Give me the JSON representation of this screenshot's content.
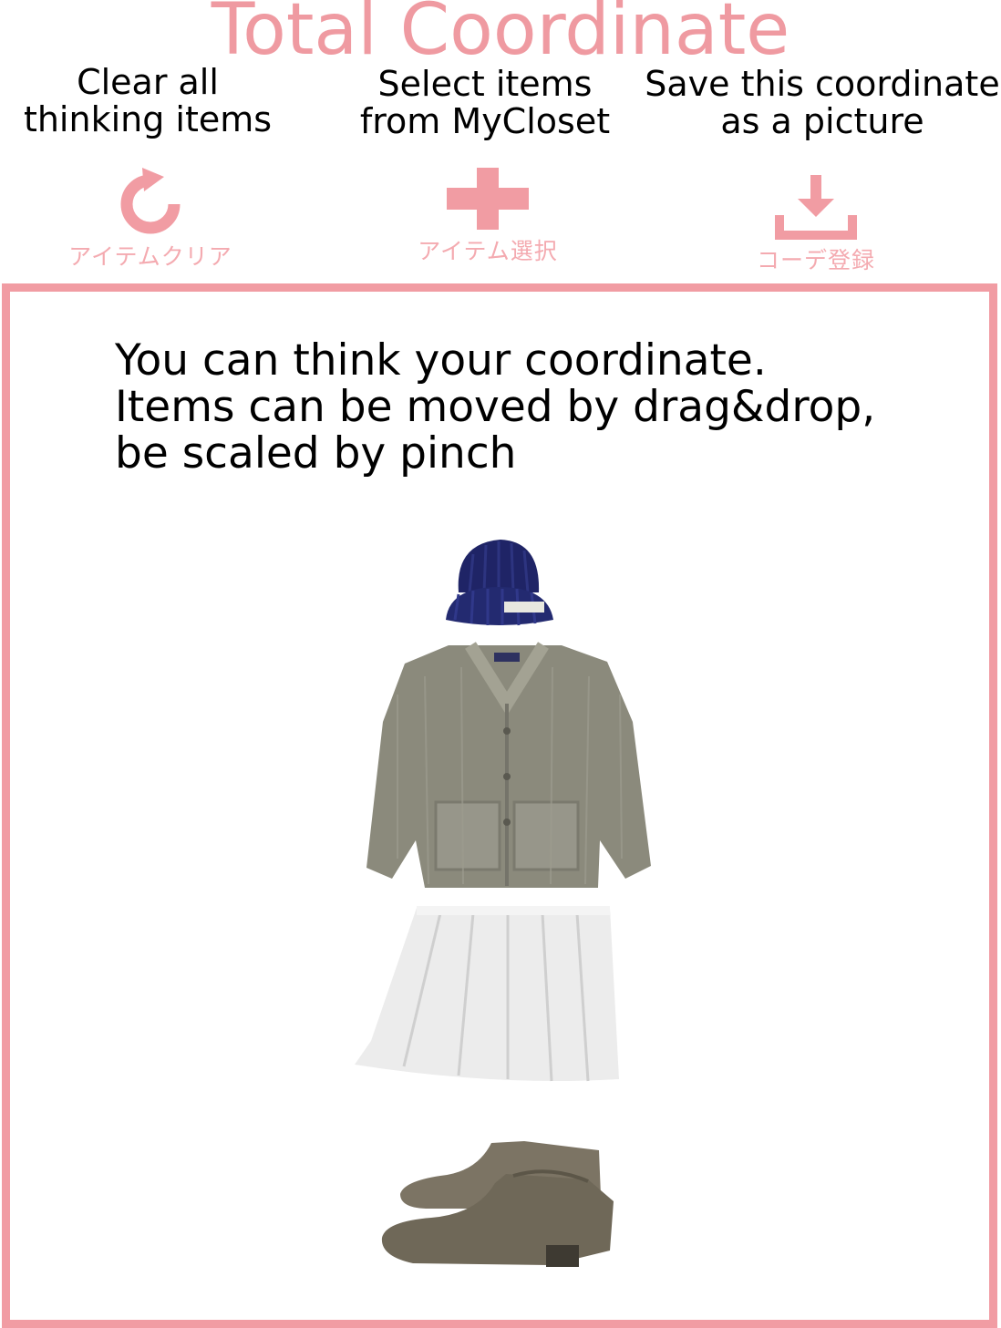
{
  "title": "Total Coordinate",
  "hints": {
    "clear": [
      "Clear all",
      "thinking items"
    ],
    "select": [
      "Select items",
      "from MyCloset"
    ],
    "save": [
      "Save this coordinate",
      "as a picture"
    ]
  },
  "toolbar": {
    "clear": {
      "icon": "refresh-icon",
      "label": "アイテムクリア"
    },
    "select": {
      "icon": "plus-icon",
      "label": "アイテム選択"
    },
    "save": {
      "icon": "download-icon",
      "label": "コーデ登録"
    }
  },
  "board": {
    "instructions": [
      "You can think your coordinate.",
      "Items can be moved by drag&drop,",
      "be scaled by pinch"
    ],
    "items": [
      "knit-hat",
      "cardigan",
      "skirt",
      "ankle-boots"
    ]
  },
  "colors": {
    "accent": "#ef9aa1",
    "border": "#f19ca3",
    "label": "#f4aab0"
  }
}
